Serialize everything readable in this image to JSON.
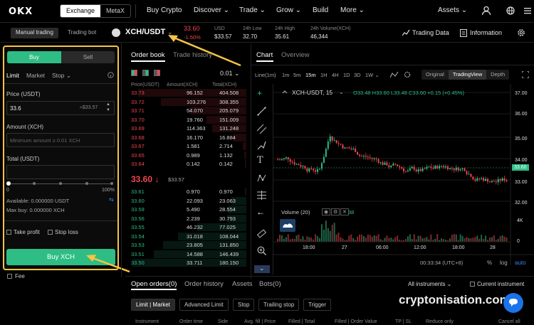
{
  "nav": {
    "exchange": "Exchange",
    "metax": "MetaX",
    "items": [
      "Buy Crypto",
      "Discover ⌄",
      "Trade ⌄",
      "Grow ⌄",
      "Build",
      "More ⌄"
    ],
    "assets": "Assets ⌄"
  },
  "sub": {
    "manual": "Manual trading",
    "bot": "Trading bot",
    "pair": "XCH/USDT",
    "price": "33.60",
    "change": "-1.50%",
    "usd_label": "USD",
    "usd_val": "$33.57",
    "low_label": "24h Low",
    "low_val": "32.70",
    "high_label": "24h High",
    "high_val": "35.61",
    "vol_label": "24h Volume(XCH)",
    "vol_val": "46,344",
    "trading_data": "Trading Data",
    "information": "Information"
  },
  "form": {
    "buy": "Buy",
    "sell": "Sell",
    "limit": "Limit",
    "market": "Market",
    "stop": "Stop ⌄",
    "price_label": "Price (USDT)",
    "price_val": "33.6",
    "price_hint": "≈$33.57",
    "amount_label": "Amount (XCH)",
    "amount_ph": "Minimum amount ≥ 0.01 XCH",
    "total_label": "Total (USDT)",
    "pct0": "0",
    "pct100": "100%",
    "available": "Available: 0.000000 USDT",
    "maxbuy": "Max buy: 0.000000 XCH",
    "take_profit": "Take profit",
    "stop_loss": "Stop loss",
    "buy_btn": "Buy XCH",
    "fee": "Fee"
  },
  "orderbook": {
    "tab1": "Order book",
    "tab2": "Trade history",
    "tick": "0.01 ⌄",
    "h_price": "Price(USDT)",
    "h_amount": "Amount(XCH)",
    "h_total": "Total(XCH)",
    "asks": [
      [
        "33.73",
        "96.152",
        "404.508"
      ],
      [
        "33.72",
        "103.276",
        "308.355"
      ],
      [
        "33.71",
        "54.070",
        "205.079"
      ],
      [
        "33.70",
        "19.760",
        "151.009"
      ],
      [
        "33.69",
        "114.363",
        "131.248"
      ],
      [
        "33.68",
        "16.170",
        "16.884"
      ],
      [
        "33.67",
        "1.581",
        "2.714"
      ],
      [
        "33.65",
        "0.989",
        "1.132"
      ],
      [
        "33.64",
        "0.142",
        "0.142"
      ]
    ],
    "mid": "33.60 ↓",
    "mid_usd": "$33.57",
    "bids": [
      [
        "33.61",
        "0.970",
        "0.970"
      ],
      [
        "33.60",
        "22.093",
        "23.063"
      ],
      [
        "33.59",
        "5.490",
        "28.554"
      ],
      [
        "33.56",
        "2.239",
        "30.793"
      ],
      [
        "33.55",
        "46.232",
        "77.025"
      ],
      [
        "33.54",
        "31.018",
        "108.044"
      ],
      [
        "33.53",
        "23.805",
        "131.850"
      ],
      [
        "33.51",
        "14.588",
        "146.439"
      ],
      [
        "33.50",
        "33.711",
        "180.150"
      ]
    ]
  },
  "chart": {
    "tab1": "Chart",
    "tab2": "Overview",
    "intervals": [
      "Line(1m)",
      "1m",
      "5m",
      "15m",
      "1H",
      "4H",
      "1D",
      "3D",
      "1W ⌄"
    ],
    "modes": [
      "Original",
      "TradingView",
      "Depth"
    ],
    "legend": "XCH-USDT, 15",
    "ohlc": "O33.48 H33.60 L33.48 C33.60 +0.15 (+0.45%)",
    "volume": "Volume (20)",
    "vol_val": "38",
    "y_labels": [
      "37.00",
      "36.00",
      "35.00",
      "34.00",
      "33.60",
      "33.00",
      "32.00"
    ],
    "vol_labels": [
      "4K",
      "0"
    ],
    "x_labels": [
      "18:00",
      "27",
      "06:00",
      "12:00",
      "18:00",
      "28"
    ],
    "clock": "00:33:34 (UTC+8)",
    "pct": "%",
    "log": "log",
    "auto": "auto"
  },
  "bottom": {
    "tabs": [
      "Open orders(0)",
      "Order history",
      "Assets",
      "Bots(0)"
    ],
    "all": "All instruments ⌄",
    "current": "Current instrument",
    "filters": [
      "Limit | Market",
      "Advanced Limit",
      "Stop",
      "Trailing stop",
      "Trigger"
    ],
    "cols": [
      "Instrument",
      "Order time",
      "Side",
      "Avg. fill | Price",
      "Filled | Total",
      "Filled | Order Value",
      "TP | SL",
      "Reduce only",
      "Cancel all"
    ]
  },
  "watermark": "cryptonisation.com",
  "colors": {
    "up": "#2ebd85",
    "down": "#f0464f",
    "accent": "#f5c542"
  }
}
